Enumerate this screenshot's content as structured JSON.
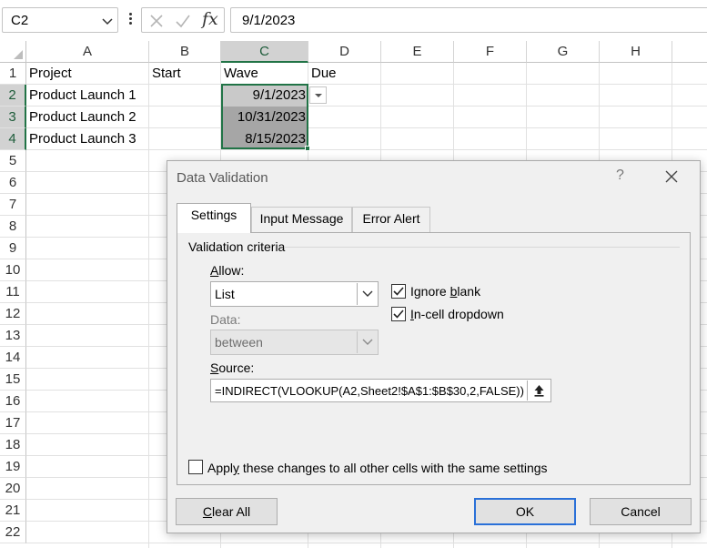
{
  "formula_bar": {
    "name_box": "C2",
    "fx_label": "fx",
    "formula": "9/1/2023"
  },
  "columns": [
    "A",
    "B",
    "C",
    "D",
    "E",
    "F",
    "G",
    "H"
  ],
  "rows": [
    "1",
    "2",
    "3",
    "4",
    "5",
    "6",
    "7",
    "8",
    "9",
    "10",
    "11",
    "12",
    "13",
    "14",
    "15",
    "16",
    "17",
    "18",
    "19",
    "20",
    "21",
    "22"
  ],
  "cells": {
    "A1": "Project",
    "B1": "Start",
    "C1": "Wave",
    "D1": "Due",
    "A2": "Product Launch 1",
    "A3": "Product Launch 2",
    "A4": "Product Launch 3",
    "C2": "9/1/2023",
    "C3": "10/31/2023",
    "C4": "8/15/2023"
  },
  "dialog": {
    "title": "Data Validation",
    "help": "?",
    "tabs": [
      "Settings",
      "Input Message",
      "Error Alert"
    ],
    "active_tab": "Settings",
    "section_label": "Validation criteria",
    "allow": {
      "label_u": "A",
      "label_rest": "llow:",
      "value": "List"
    },
    "ignore_blank": {
      "pre": "Ignore ",
      "u": "b",
      "rest": "lank",
      "checked": true
    },
    "in_cell_dropdown": {
      "pre": "",
      "u": "I",
      "rest": "n-cell dropdown",
      "checked": true
    },
    "data": {
      "label": "Data:",
      "value": "between"
    },
    "source": {
      "label_u": "S",
      "label_rest": "ource:",
      "value": "=INDIRECT(VLOOKUP(A2,Sheet2!$A$1:$B$30,2,FALSE))"
    },
    "apply_all": {
      "pre": "Appl",
      "u": "y",
      "rest": " these changes to all other cells with the same settings",
      "checked": false
    },
    "buttons": {
      "clear_u": "C",
      "clear_rest": "lear All",
      "ok": "OK",
      "cancel": "Cancel"
    }
  }
}
